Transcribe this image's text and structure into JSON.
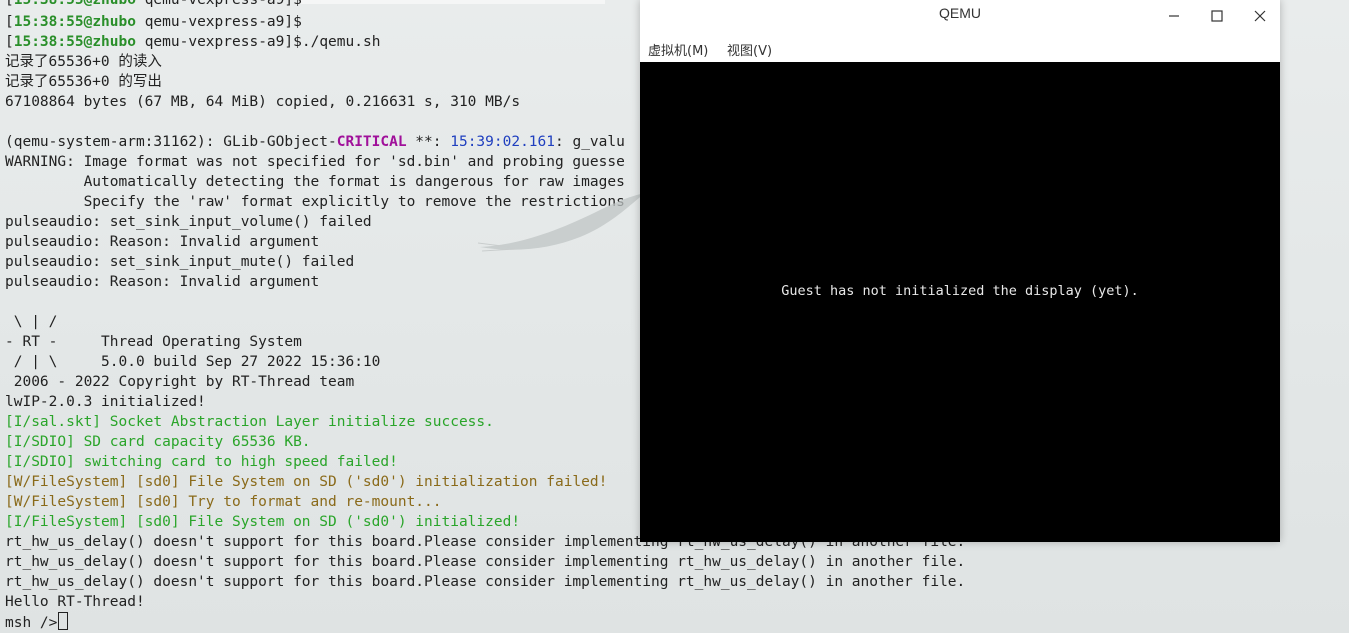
{
  "terminal": {
    "prompt_user_host": "zhubo",
    "prompt_time": "15:38:55",
    "prompt_dir": "qemu-vexpress-a9",
    "cmd_run": "./qemu.sh",
    "l_read": "记录了65536+0 的读入",
    "l_write": "记录了65536+0 的写出",
    "l_copied": "67108864 bytes (67 MB, 64 MiB) copied, 0.216631 s, 310 MB/s",
    "l_glib_pre": "(qemu-system-arm:31162): GLib-GObject-",
    "l_glib_crit": "CRITICAL",
    "l_glib_mid": " **: ",
    "l_glib_ts": "15:39:02.161",
    "l_glib_post": ": g_valu",
    "l_warn1": "WARNING: Image format was not specified for 'sd.bin' and probing guesse",
    "l_warn2": "         Automatically detecting the format is dangerous for raw images",
    "l_warn3": "         Specify the 'raw' format explicitly to remove the restrictions",
    "l_pa1": "pulseaudio: set_sink_input_volume() failed",
    "l_pa2": "pulseaudio: Reason: Invalid argument",
    "l_pa3": "pulseaudio: set_sink_input_mute() failed",
    "l_pa4": "pulseaudio: Reason: Invalid argument",
    "l_logo1": " \\ | /",
    "l_logo2": "- RT -     Thread Operating System",
    "l_logo3": " / | \\     5.0.0 build Sep 27 2022 15:36:10",
    "l_logo4": " 2006 - 2022 Copyright by RT-Thread team",
    "l_lwip": "lwIP-2.0.3 initialized!",
    "l_sal": "[I/sal.skt] Socket Abstraction Layer initialize success.",
    "l_sd1": "[I/SDIO] SD card capacity 65536 KB.",
    "l_sd2": "[I/SDIO] switching card to high speed failed!",
    "l_fs1": "[W/FileSystem] [sd0] File System on SD ('sd0') initialization failed!",
    "l_fs2": "[W/FileSystem] [sd0] Try to format and re-mount...",
    "l_fs3": "[I/FileSystem] [sd0] File System on SD ('sd0') initialized!",
    "l_delay": "rt_hw_us_delay() doesn't support for this board.Please consider implementing rt_hw_us_delay() in another file.",
    "l_hello": "Hello RT-Thread!",
    "l_msh": "msh />"
  },
  "qemu": {
    "title": "QEMU",
    "menu_machine": "虚拟机(M)",
    "menu_view": "视图(V)",
    "guest_message": "Guest has not initialized the display (yet)."
  }
}
